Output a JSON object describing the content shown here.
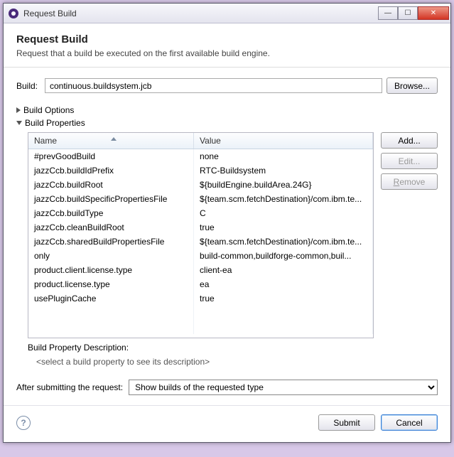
{
  "window": {
    "title": "Request Build"
  },
  "header": {
    "title": "Request Build",
    "subtitle": "Request that a build be executed on the first available build engine."
  },
  "build_row": {
    "label": "Build:",
    "value": "continuous.buildsystem.jcb",
    "browse": "Browse..."
  },
  "sections": {
    "options": "Build Options",
    "properties": "Build Properties"
  },
  "columns": {
    "name": "Name",
    "value": "Value"
  },
  "properties": [
    {
      "name": "#prevGoodBuild",
      "value": "none"
    },
    {
      "name": "jazzCcb.buildIdPrefix",
      "value": "RTC-Buildsystem"
    },
    {
      "name": "jazzCcb.buildRoot",
      "value": "${buildEngine.buildArea.24G}"
    },
    {
      "name": "jazzCcb.buildSpecificPropertiesFile",
      "value": "${team.scm.fetchDestination}/com.ibm.te..."
    },
    {
      "name": "jazzCcb.buildType",
      "value": "C"
    },
    {
      "name": "jazzCcb.cleanBuildRoot",
      "value": "true"
    },
    {
      "name": "jazzCcb.sharedBuildPropertiesFile",
      "value": "${team.scm.fetchDestination}/com.ibm.te..."
    },
    {
      "name": "only",
      "value": "build-common,buildforge-common,buil..."
    },
    {
      "name": "product.client.license.type",
      "value": "client-ea"
    },
    {
      "name": "product.license.type",
      "value": "ea"
    },
    {
      "name": "usePluginCache",
      "value": "true"
    }
  ],
  "side_buttons": {
    "add": "Add...",
    "edit": "Edit...",
    "remove": "Remove"
  },
  "description": {
    "label": "Build Property Description:",
    "hint": "<select a build property to see its description>"
  },
  "after": {
    "label": "After submitting the request:",
    "selected": "Show builds of the requested type"
  },
  "footer": {
    "submit": "Submit",
    "cancel": "Cancel"
  }
}
